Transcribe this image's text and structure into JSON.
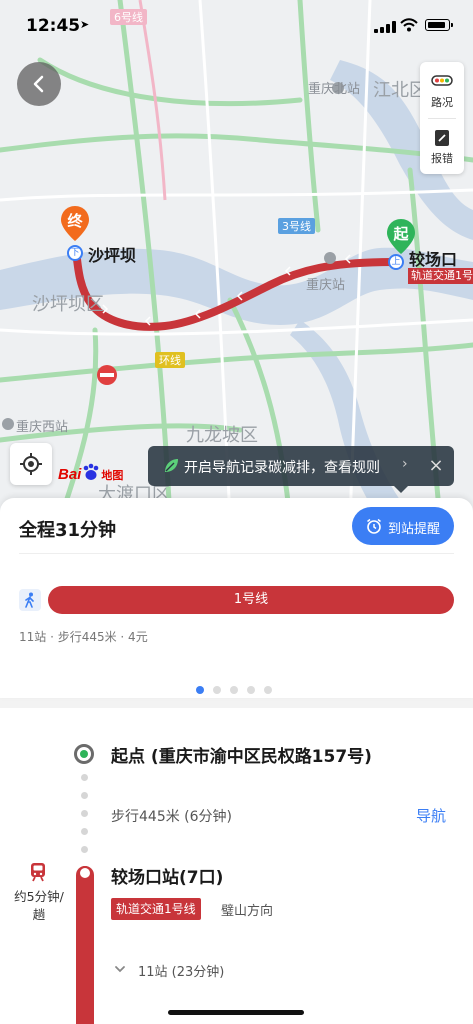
{
  "status_bar": {
    "time": "12:45"
  },
  "map": {
    "labels": {
      "line6": "6号线",
      "line3": "3号线",
      "ring": "环线",
      "chongqing_north": "重庆北站",
      "jiangbei": "江北区",
      "chongqing_station": "重庆站",
      "shapingba_district": "沙坪坝区",
      "chongqing_west": "重庆西站",
      "jiulongpo": "九龙坡区",
      "dadukou": "大渡口区"
    },
    "end_marker": {
      "char": "终",
      "station": "沙坪坝"
    },
    "start_marker": {
      "char": "起",
      "station": "较场口",
      "line_tag": "轨道交通1号"
    },
    "route_color": "#c8353a"
  },
  "tools": [
    {
      "label": "路况",
      "icon": "traffic-icon"
    },
    {
      "label": "报错",
      "icon": "report-error-icon"
    }
  ],
  "logo": {
    "text1": "Bai",
    "text2": "地图"
  },
  "tip": {
    "text": "开启导航记录碳减排，查看规则",
    "chevron": "›",
    "close": "×"
  },
  "route": {
    "total": "全程31分钟",
    "remind_label": "到站提醒",
    "line_name": "1号线",
    "meta": "11站 · 步行445米 · 4元",
    "page_count": 5,
    "active_page": 0
  },
  "steps": {
    "start": "起点 (重庆市渝中区民权路157号)",
    "walk": "步行445米 (6分钟)",
    "nav": "导航",
    "frequency": "约5分钟/趟",
    "station": "较场口站(7口)",
    "line_tag": "轨道交通1号线",
    "direction": "璧山方向",
    "stops": "11站 (23分钟)"
  },
  "colors": {
    "accent": "#3b7ef4",
    "line1": "#c8353a",
    "start_green": "#2fb45a",
    "end_orange": "#f26b1d"
  }
}
